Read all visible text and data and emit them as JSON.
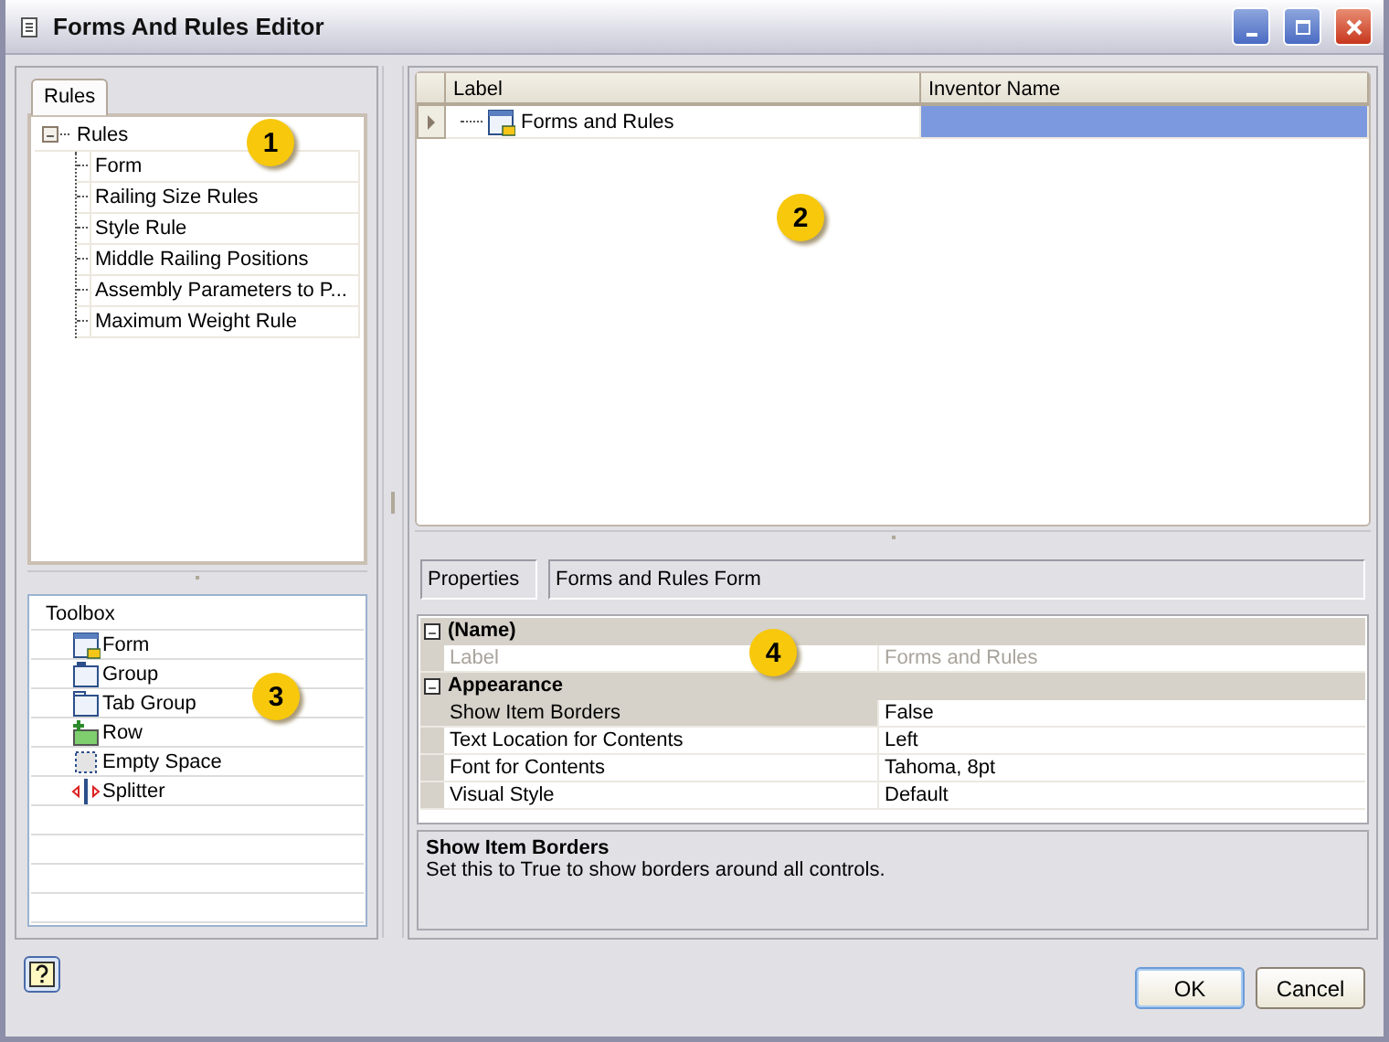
{
  "window": {
    "title": "Forms And Rules Editor"
  },
  "rules_panel": {
    "tabs": [
      {
        "label": "Rules",
        "selected": true
      }
    ],
    "tree": {
      "label": "Rules",
      "expanded": true,
      "children": [
        {
          "label": "Form"
        },
        {
          "label": "Railing Size Rules"
        },
        {
          "label": "Style Rule"
        },
        {
          "label": "Middle Railing Positions"
        },
        {
          "label": "Assembly Parameters to P..."
        },
        {
          "label": "Maximum Weight Rule"
        }
      ]
    }
  },
  "toolbox": {
    "header": "Toolbox",
    "items": [
      {
        "label": "Form",
        "kind": "form"
      },
      {
        "label": "Group",
        "kind": "group"
      },
      {
        "label": "Tab Group",
        "kind": "tab_group"
      },
      {
        "label": "Row",
        "kind": "row"
      },
      {
        "label": "Empty Space",
        "kind": "empty_space"
      },
      {
        "label": "Splitter",
        "kind": "splitter"
      }
    ]
  },
  "grid": {
    "columns": [
      "Label",
      "Inventor Name"
    ],
    "rows": [
      {
        "label": "Forms and Rules",
        "selected": true
      }
    ]
  },
  "properties": {
    "caption": "Properties",
    "object": "Forms and Rules Form",
    "categories": [
      {
        "name": "(Name)",
        "expanded": true,
        "items": [
          {
            "name": "Label",
            "value": "Forms and Rules",
            "disabled": true,
            "selected": false
          }
        ]
      },
      {
        "name": "Appearance",
        "expanded": true,
        "items": [
          {
            "name": "Show Item Borders",
            "value": "False",
            "disabled": false,
            "selected": true
          },
          {
            "name": "Text Location for Contents",
            "value": "Left",
            "disabled": false,
            "selected": false
          },
          {
            "name": "Font for Contents",
            "value": "Tahoma, 8pt",
            "disabled": false,
            "selected": false
          },
          {
            "name": "Visual Style",
            "value": "Default",
            "disabled": false,
            "selected": false
          }
        ]
      }
    ],
    "description": {
      "title": "Show Item Borders",
      "text": "Set this to True to show borders around all controls."
    }
  },
  "callouts": [
    "1",
    "2",
    "3",
    "4"
  ],
  "buttons": [
    {
      "label": "OK",
      "default": true
    },
    {
      "label": "Cancel",
      "default": false
    }
  ]
}
